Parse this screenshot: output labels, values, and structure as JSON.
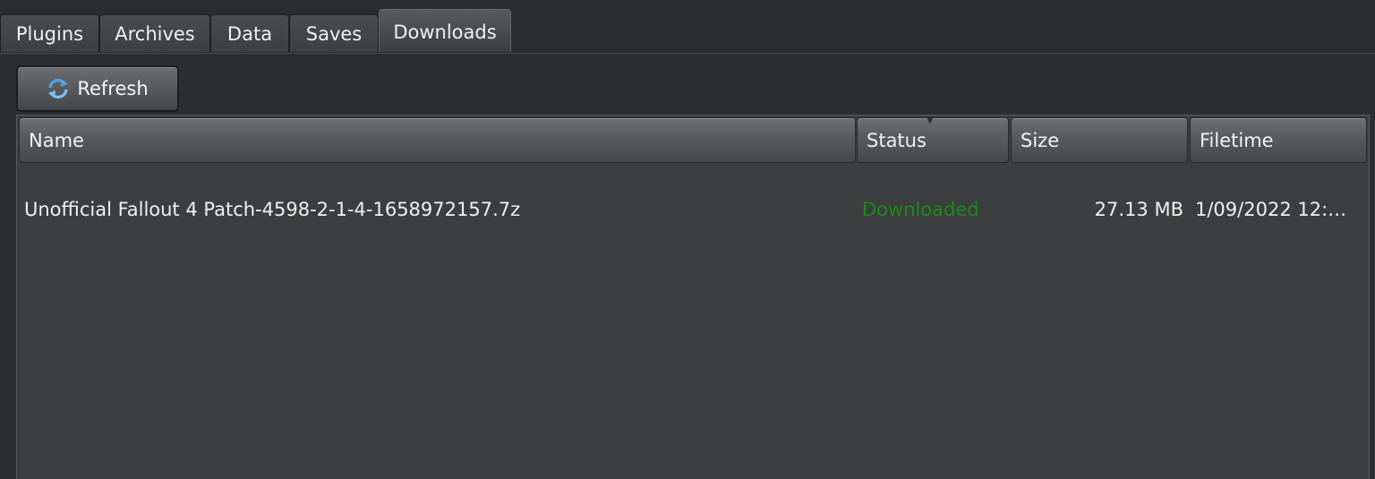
{
  "tabs": [
    {
      "label": "Plugins",
      "active": false
    },
    {
      "label": "Archives",
      "active": false
    },
    {
      "label": "Data",
      "active": false
    },
    {
      "label": "Saves",
      "active": false
    },
    {
      "label": "Downloads",
      "active": true
    }
  ],
  "toolbar": {
    "refresh_label": "Refresh",
    "refresh_icon": "refresh-icon"
  },
  "table": {
    "columns": [
      "Name",
      "Status",
      "Size",
      "Filetime"
    ],
    "sorted_column": "Status",
    "rows": [
      {
        "name": "Unofficial Fallout 4 Patch-4598-2-1-4-1658972157.7z",
        "status": "Downloaded",
        "size": "27.13 MB",
        "filetime": "1/09/2022 12:4..."
      }
    ]
  },
  "colors": {
    "background": "#2d2e30",
    "table_background": "#3d3e3f",
    "status_downloaded": "#1a8a1a",
    "icon_blue": "#4aa3e8"
  }
}
